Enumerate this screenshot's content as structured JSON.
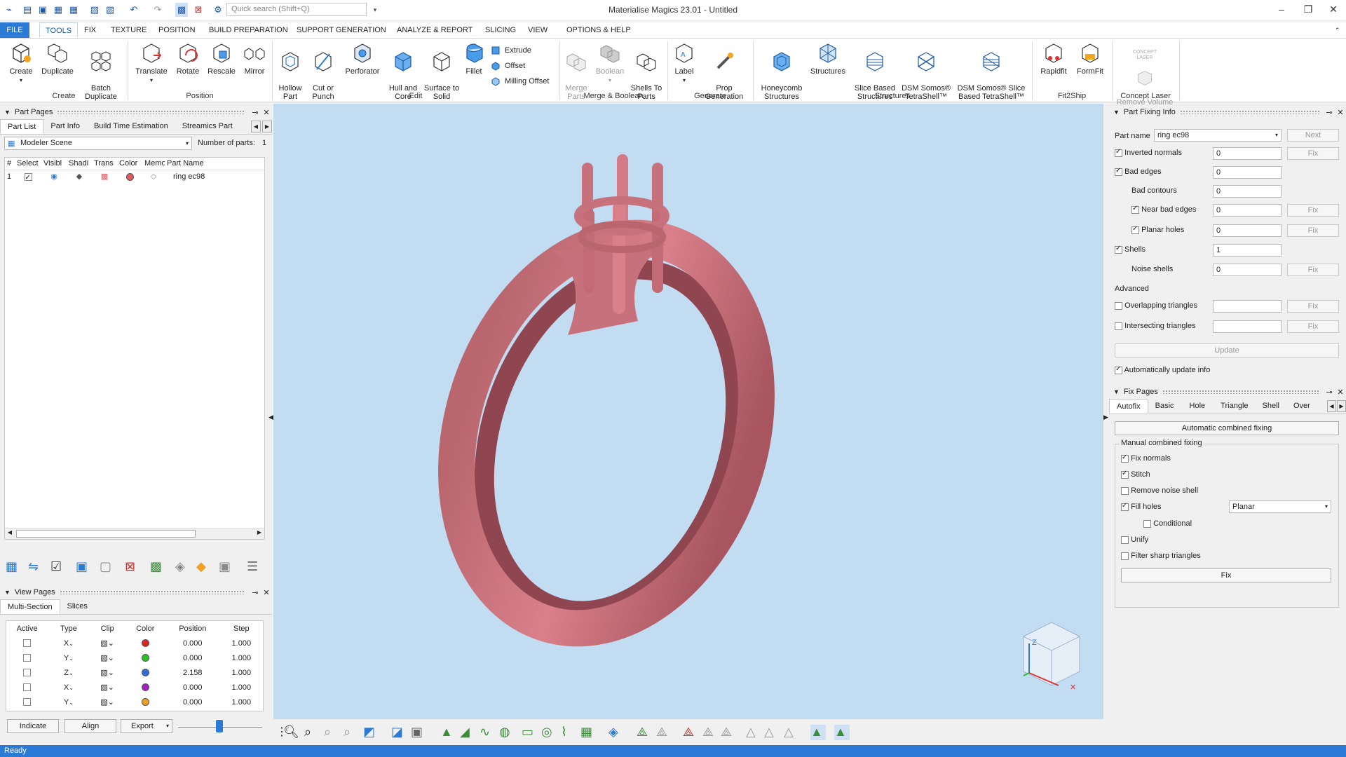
{
  "window": {
    "title": "Materialise Magics 23.01 - Untitled",
    "search_placeholder": "Quick search (Shift+Q)"
  },
  "menu_tabs": [
    "FILE",
    "TOOLS",
    "FIX",
    "TEXTURE",
    "POSITION",
    "BUILD PREPARATION",
    "SUPPORT GENERATION",
    "ANALYZE & REPORT",
    "SLICING",
    "VIEW",
    "OPTIONS & HELP"
  ],
  "ribbon": {
    "create": [
      "Create",
      "Duplicate",
      "Batch\nDuplicate"
    ],
    "position": [
      "Translate",
      "Rotate",
      "Rescale",
      "Mirror"
    ],
    "edit": [
      "Hollow\nPart",
      "Cut or\nPunch",
      "Perforator",
      "Hull and\nCore",
      "Surface to\nSolid",
      "Fillet"
    ],
    "edit_small": [
      "Extrude",
      "Offset",
      "Milling Offset"
    ],
    "merge": [
      "Merge\nParts",
      "Boolean",
      "Shells To\nParts"
    ],
    "generate": [
      "Label",
      "Prop\nGeneration"
    ],
    "structures": [
      "Honeycomb\nStructures",
      "Structures",
      "Slice Based\nStructures",
      "DSM Somos®\nTetraShell™",
      "DSM Somos® Slice\nBased TetraShell™"
    ],
    "fit2ship": [
      "Rapidfit",
      "FormFit"
    ],
    "concept": [
      "Remove Volume\nWizard"
    ],
    "concept_logo": "CONCEPT LASER",
    "groups": [
      "Create",
      "Position",
      "Edit",
      "Merge & Boolean",
      "Generate",
      "Structures",
      "Fit2Ship",
      "Concept Laser"
    ]
  },
  "part_pages": {
    "title": "Part Pages",
    "tabs": [
      "Part List",
      "Part Info",
      "Build Time Estimation",
      "Streamics Part"
    ],
    "scene": "Modeler Scene",
    "num_parts_label": "Number of parts:",
    "num_parts": "1",
    "columns": [
      "#",
      "Select",
      "Visibl",
      "Shadi",
      "Trans",
      "Color",
      "Memo",
      "Part Name"
    ],
    "rows": [
      {
        "num": "1",
        "name": "ring ec98",
        "color": "#e05860"
      }
    ]
  },
  "view_pages": {
    "title": "View Pages",
    "tabs": [
      "Multi-Section",
      "Slices"
    ],
    "columns": [
      "Active",
      "Type",
      "Clip",
      "Color",
      "Position",
      "Step"
    ],
    "rows": [
      {
        "type": "X",
        "color": "#e02424",
        "position": "0.000",
        "step": "1.000"
      },
      {
        "type": "Y",
        "color": "#2bbf2b",
        "position": "0.000",
        "step": "1.000"
      },
      {
        "type": "Z",
        "color": "#2a70d8",
        "position": "2.158",
        "step": "1.000"
      },
      {
        "type": "X",
        "color": "#a020c0",
        "position": "0.000",
        "step": "1.000"
      },
      {
        "type": "Y",
        "color": "#f0a020",
        "position": "0.000",
        "step": "1.000"
      }
    ],
    "buttons": [
      "Indicate",
      "Align",
      "Export"
    ]
  },
  "fixing_info": {
    "title": "Part Fixing Info",
    "part_name_label": "Part name",
    "part_name": "ring ec98",
    "next": "Next",
    "fix": "Fix",
    "rows": [
      {
        "label": "Inverted normals",
        "value": "0"
      },
      {
        "label": "Bad edges",
        "value": "0"
      },
      {
        "label": "Bad contours",
        "value": "0"
      },
      {
        "label": "Near bad edges",
        "value": "0"
      },
      {
        "label": "Planar holes",
        "value": "0"
      },
      {
        "label": "Shells",
        "value": "1"
      },
      {
        "label": "Noise shells",
        "value": "0"
      }
    ],
    "advanced": "Advanced",
    "overlapping": "Overlapping triangles",
    "intersecting": "Intersecting triangles",
    "update": "Update",
    "auto_update": "Automatically update info"
  },
  "fix_pages": {
    "title": "Fix Pages",
    "tabs": [
      "Autofix",
      "Basic",
      "Hole",
      "Triangle",
      "Shell",
      "Over"
    ],
    "auto_combined": "Automatic combined fixing",
    "manual_label": "Manual combined fixing",
    "options": [
      "Fix normals",
      "Stitch",
      "Remove noise shell",
      "Fill holes",
      "Conditional",
      "Unify",
      "Filter sharp triangles"
    ],
    "fill_mode": "Planar",
    "fix_button": "Fix"
  },
  "axes": {
    "z": "Z"
  },
  "status": "Ready",
  "colors": {
    "accent": "#2b7bd6",
    "viewport": "#c2dcf2",
    "part": "#d9808a"
  }
}
